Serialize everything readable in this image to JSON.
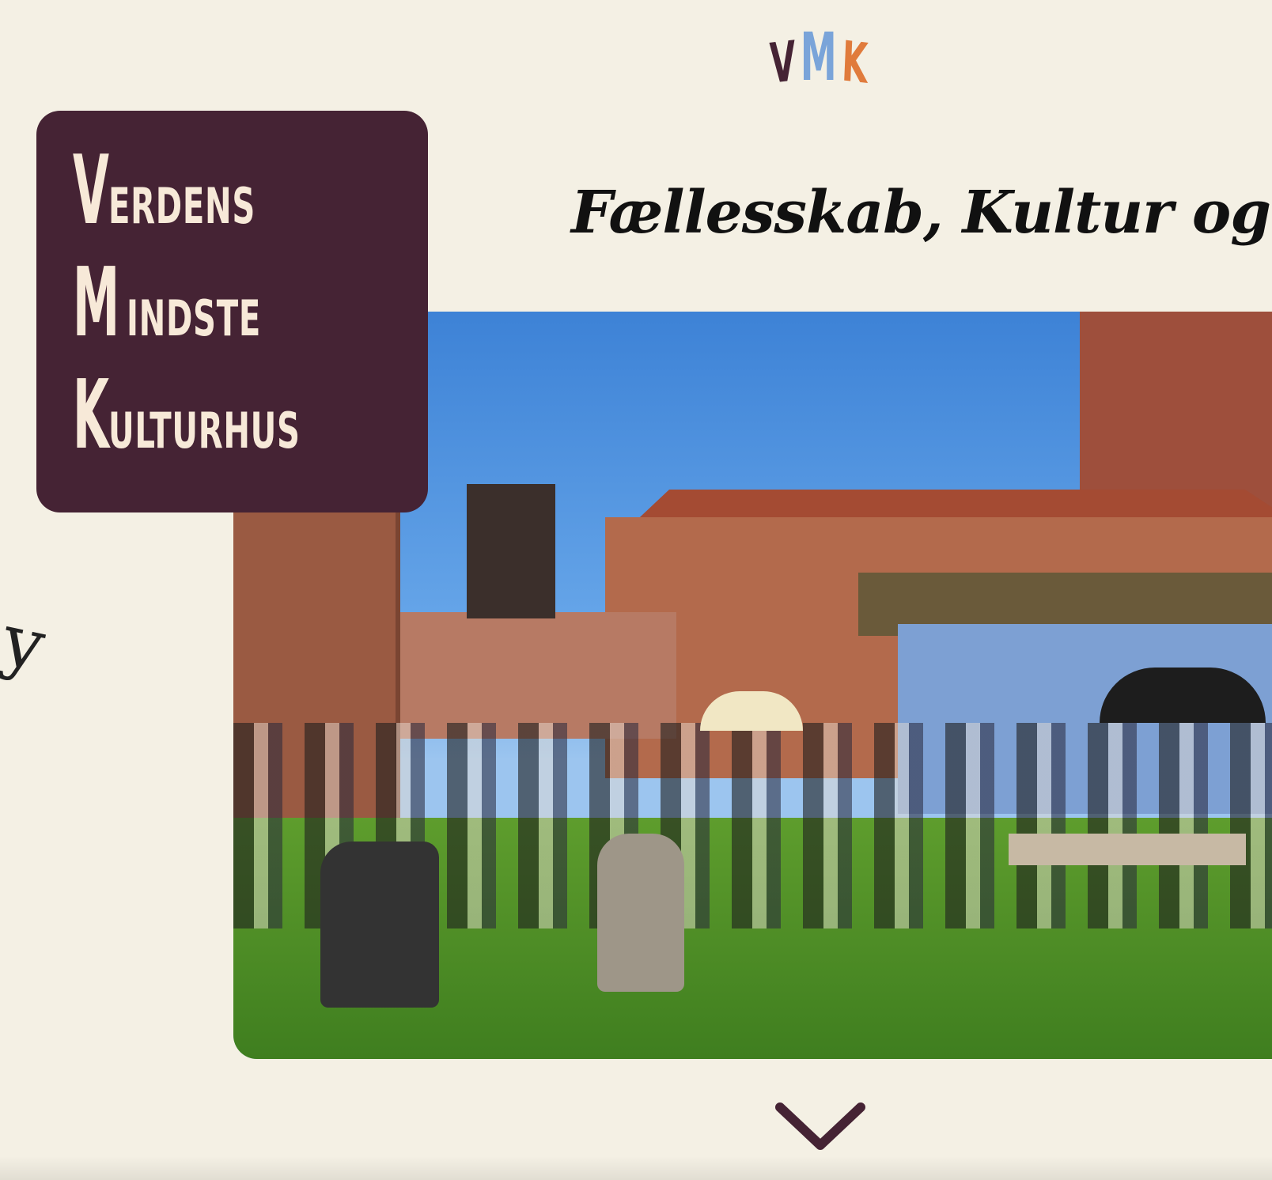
{
  "logo": {
    "letters": [
      "V",
      "M",
      "K"
    ],
    "colors": [
      "#452334",
      "#7aa4d9",
      "#e07b3c"
    ]
  },
  "title_card": {
    "lines": [
      {
        "cap": "V",
        "rest": "ERDENS"
      },
      {
        "cap": "M",
        "rest": "INDSTE"
      },
      {
        "cap": "K",
        "rest": "ULTURHUS"
      }
    ],
    "background": "#452334",
    "text_color": "#f7e9d8"
  },
  "headline": "Fællesskab, Kultur og I",
  "scribble": "y",
  "scroll_icon": "chevron-down-icon",
  "colors": {
    "page_bg": "#f4f0e4",
    "chevron": "#452334"
  }
}
